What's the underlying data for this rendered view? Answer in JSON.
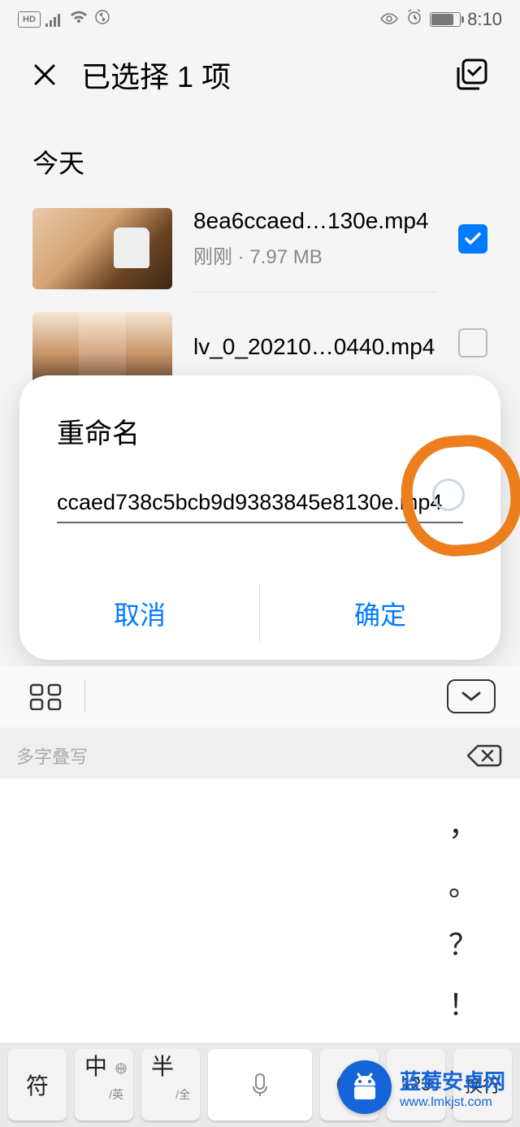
{
  "status": {
    "hd": "HD",
    "time": "8:10"
  },
  "header": {
    "title": "已选择 1 项"
  },
  "section": "今天",
  "files": [
    {
      "name": "8ea6ccaed…130e.mp4",
      "meta": "刚刚 · 7.97 MB",
      "checked": true
    },
    {
      "name": "lv_0_20210…0440.mp4",
      "meta": "",
      "checked": false
    }
  ],
  "dialog": {
    "title": "重命名",
    "value": "ccaed738c5bcb9d9383845e8130e.mp4",
    "cancel": "取消",
    "confirm": "确定"
  },
  "ime": {
    "hint": "多字叠写",
    "puncts": [
      "，",
      "。",
      "？",
      "！"
    ],
    "keys": {
      "symbol": "符",
      "langMain": "中",
      "langSub": "/英",
      "halfMain": "半",
      "halfSub": "/全",
      "num": "123",
      "enter": "换行"
    }
  },
  "watermark": {
    "title": "蓝莓安卓网",
    "url": "www.lmkjst.com"
  }
}
